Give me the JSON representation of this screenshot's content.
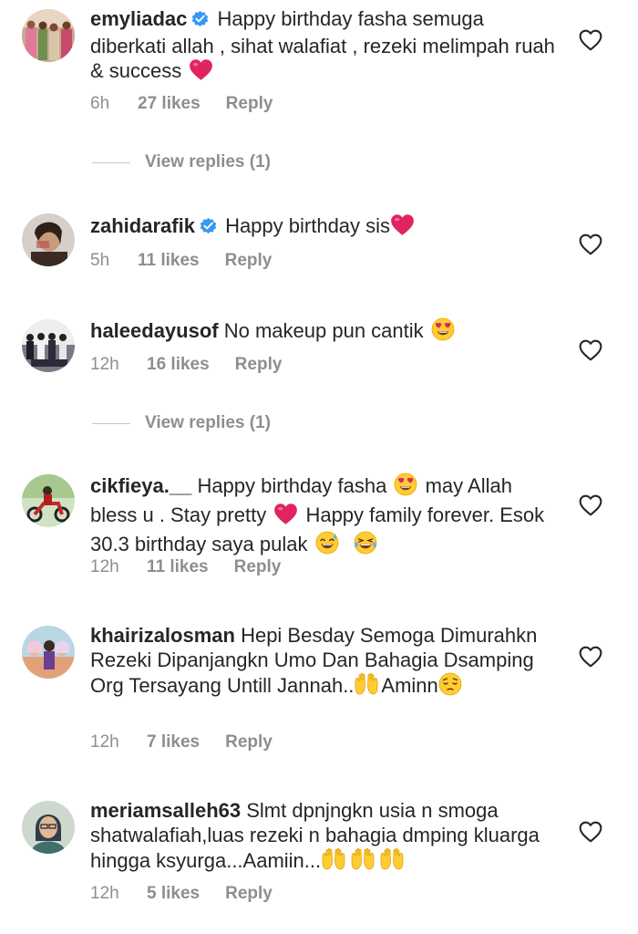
{
  "comments": [
    {
      "username": "emyliadac",
      "verified": true,
      "text": "Happy birthday fasha semuga diberkati allah , sihat walafiat , rezeki melimpah ruah & success",
      "emoji_after": "red-heart",
      "time": "6h",
      "likes": "27 likes",
      "reply": "Reply",
      "view_replies": "View replies (1)"
    },
    {
      "username": "zahidarafik",
      "verified": true,
      "text": "Happy birthday sis",
      "emoji_after": "red-heart",
      "time": "5h",
      "likes": "11 likes",
      "reply": "Reply"
    },
    {
      "username": "haleedayusof",
      "verified": false,
      "text": "No makeup pun cantik",
      "emoji_after": "heart-eyes",
      "time": "12h",
      "likes": "16 likes",
      "reply": "Reply",
      "view_replies": "View replies (1)"
    },
    {
      "username": "cikfieya.__",
      "verified": false,
      "text_part1": "Happy birthday fasha",
      "text_part2": "may Allah bless u . Stay pretty",
      "text_part3": "Happy family forever. Esok 30.3 birthday saya pulak",
      "time": "12h",
      "likes": "11 likes",
      "reply": "Reply"
    },
    {
      "username": "khairizalosman",
      "verified": false,
      "text_part1": "Hepi Besday Semoga Dimurahkn Rezeki Dipanjangkn Umo Dan Bahagia Dsamping Org Tersayang Untill Jannah..",
      "text_part2": "Aminn",
      "time": "12h",
      "likes": "7 likes",
      "reply": "Reply"
    },
    {
      "username": "meriamsalleh63",
      "verified": false,
      "text": "Slmt dpnjngkn usia n smoga shatwalafiah,luas rezeki n bahagia dmping kluarga hingga ksyurga...Aamiin...",
      "time": "12h",
      "likes": "5 likes",
      "reply": "Reply"
    }
  ],
  "icons": {
    "like": "heart-outline-icon",
    "verified": "verified-badge-icon"
  },
  "colors": {
    "text": "#262626",
    "secondary": "#8e8e8e",
    "verified_blue": "#3897f0",
    "heart_red": "#e0245e"
  }
}
